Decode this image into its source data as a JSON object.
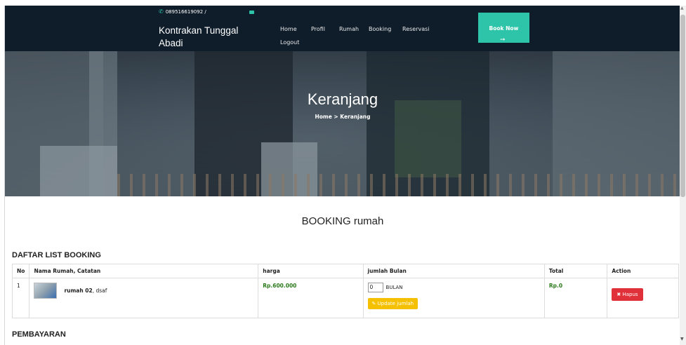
{
  "topbar": {
    "phone": "089516619092 /"
  },
  "nav": {
    "brand": "Kontrakan Tunggal Abadi",
    "links": [
      "Home",
      "Profil",
      "Rumah",
      "Booking",
      "Reservasi",
      "Logout"
    ],
    "book_now": "Book Now"
  },
  "hero": {
    "title": "Keranjang",
    "breadcrumb": "Home > Keranjang"
  },
  "page": {
    "section_title": "BOOKING rumah",
    "list_title": "DAFTAR LIST BOOKING",
    "payment_title": "PEMBAYARAN"
  },
  "table": {
    "headers": [
      "No",
      "Nama Rumah, Catatan",
      "harga",
      "jumlah Bulan",
      "Total",
      "Action"
    ],
    "rows": [
      {
        "no": "1",
        "name": "rumah 02",
        "note": ", dsaf",
        "price": "Rp.600.000",
        "qty": "0",
        "unit": "BULAN",
        "update_label": "Update jumlah",
        "total": "Rp.0",
        "delete_label": "Hapus"
      }
    ]
  },
  "colors": {
    "navbar": "#0f1d2b",
    "accent": "#2ec4a9",
    "update": "#f5c000",
    "delete": "#e0303a"
  }
}
